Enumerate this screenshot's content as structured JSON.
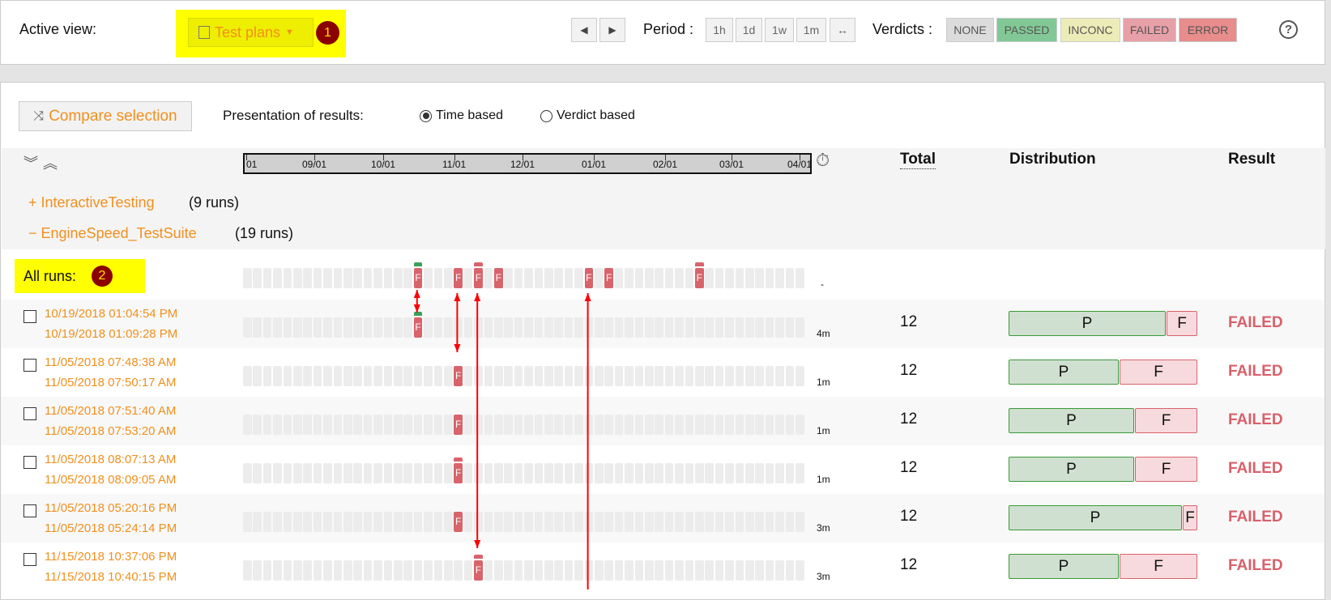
{
  "topbar": {
    "active_view_label": "Active view:",
    "view_button": "Test plans",
    "view_badge": "1",
    "prev_icon": "triangle-left-icon",
    "next_icon": "triangle-right-icon",
    "period_label": "Period :",
    "periods": [
      "1h",
      "1d",
      "1w",
      "1m",
      "↔"
    ],
    "verdicts_label": "Verdicts :",
    "verdicts": [
      {
        "label": "NONE",
        "color": "#dcdcdc"
      },
      {
        "label": "PASSED",
        "color": "#82c896"
      },
      {
        "label": "INCONC",
        "color": "#ececb8"
      },
      {
        "label": "FAILED",
        "color": "#e8a0a8"
      },
      {
        "label": "ERROR",
        "color": "#e88c8c"
      }
    ],
    "help_icon": "question-circle-icon"
  },
  "toolbar": {
    "compare_button": "Compare selection",
    "presentation_label": "Presentation of results:",
    "radio_time": "Time based",
    "radio_verdict": "Verdict based",
    "selected": "Time based"
  },
  "header": {
    "timeline_ticks": [
      "01",
      "09/01",
      "10/01",
      "11/01",
      "12/01",
      "01/01",
      "02/01",
      "03/01",
      "04/01"
    ],
    "total": "Total",
    "distribution": "Distribution",
    "result": "Result"
  },
  "groups": [
    {
      "name": "+ InteractiveTesting",
      "runs": "(9 runs)"
    },
    {
      "name": "− EngineSpeed_TestSuite",
      "runs": "(19 runs)"
    }
  ],
  "all_runs": {
    "label": "All runs:",
    "badge": "2",
    "duration": "-",
    "failed_bins": [
      17,
      21,
      23,
      25,
      34,
      36,
      45
    ],
    "marks": {
      "17": "passed",
      "23": "failed",
      "45": "failed"
    }
  },
  "cell_letter": "F",
  "colors": {
    "failed": "#d9636b",
    "passed": "#3aa05a",
    "accent": "#f0901e"
  },
  "rows": [
    {
      "start": "10/19/2018 01:04:54 PM",
      "end": "10/19/2018 01:09:28 PM",
      "duration": "4m",
      "total": "12",
      "passed": 10,
      "failed": 2,
      "result": "FAILED",
      "bin": 17,
      "mark": "passed"
    },
    {
      "start": "11/05/2018 07:48:38 AM",
      "end": "11/05/2018 07:50:17 AM",
      "duration": "1m",
      "total": "12",
      "passed": 7,
      "failed": 5,
      "result": "FAILED",
      "bin": 21,
      "mark": ""
    },
    {
      "start": "11/05/2018 07:51:40 AM",
      "end": "11/05/2018 07:53:20 AM",
      "duration": "1m",
      "total": "12",
      "passed": 8,
      "failed": 4,
      "result": "FAILED",
      "bin": 21,
      "mark": ""
    },
    {
      "start": "11/05/2018 08:07:13 AM",
      "end": "11/05/2018 08:09:05 AM",
      "duration": "1m",
      "total": "12",
      "passed": 8,
      "failed": 4,
      "result": "FAILED",
      "bin": 21,
      "mark": "failed"
    },
    {
      "start": "11/05/2018 05:20:16 PM",
      "end": "11/05/2018 05:24:14 PM",
      "duration": "3m",
      "total": "12",
      "passed": 11,
      "failed": 1,
      "result": "FAILED",
      "bin": 21,
      "mark": ""
    },
    {
      "start": "11/15/2018 10:37:06 PM",
      "end": "11/15/2018 10:40:15 PM",
      "duration": "3m",
      "total": "12",
      "passed": 7,
      "failed": 5,
      "result": "FAILED",
      "bin": 23,
      "mark": "failed"
    }
  ],
  "dist_letters": {
    "passed": "P",
    "failed": "F"
  }
}
